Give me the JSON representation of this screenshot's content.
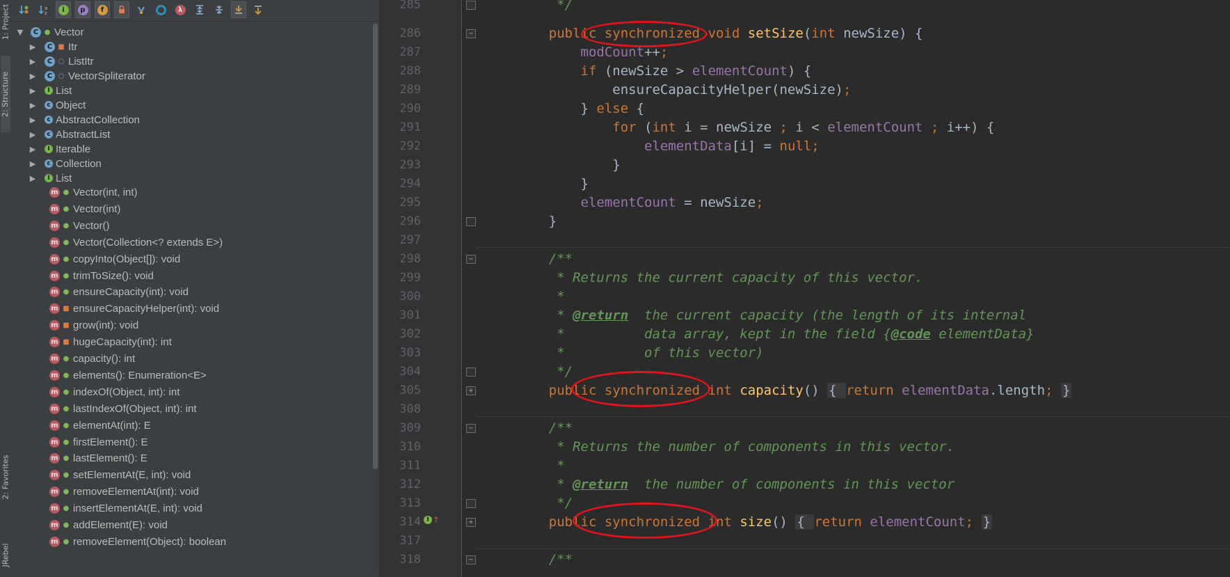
{
  "side_tabs": {
    "project": "1: Project",
    "structure": "2: Structure",
    "favorites": "2: Favorites",
    "jrebel": "JRebel"
  },
  "toolbar": {
    "buttons": [
      "sort-by-visibility",
      "sort-alphabetically",
      "show-inherited",
      "show-properties",
      "show-fields",
      "show-non-public",
      "show-anonymous",
      "show-lambdas",
      "expand-all",
      "collapse-all",
      "autoscroll-to-source",
      "autoscroll-from-source"
    ],
    "show_properties_letter": "p",
    "show_fields_letter": "f",
    "show_lambdas_letter": "λ"
  },
  "structure_tree": {
    "root": "Vector",
    "children": [
      {
        "label": "Itr",
        "kind": "class",
        "vis": "private"
      },
      {
        "label": "ListItr",
        "kind": "class",
        "vis": "package"
      },
      {
        "label": "VectorSpliterator",
        "kind": "class",
        "vis": "package"
      },
      {
        "label": "List",
        "kind": "interface"
      },
      {
        "label": "Object",
        "kind": "class"
      },
      {
        "label": "AbstractCollection",
        "kind": "class"
      },
      {
        "label": "AbstractList",
        "kind": "class"
      },
      {
        "label": "Iterable",
        "kind": "interface"
      },
      {
        "label": "Collection",
        "kind": "interface"
      },
      {
        "label": "List",
        "kind": "interface"
      }
    ],
    "methods": [
      {
        "label": "Vector(int, int)",
        "vis": "public"
      },
      {
        "label": "Vector(int)",
        "vis": "public"
      },
      {
        "label": "Vector()",
        "vis": "public"
      },
      {
        "label": "Vector(Collection<? extends E>)",
        "vis": "public"
      },
      {
        "label": "copyInto(Object[]): void",
        "vis": "public"
      },
      {
        "label": "trimToSize(): void",
        "vis": "public"
      },
      {
        "label": "ensureCapacity(int): void",
        "vis": "public"
      },
      {
        "label": "ensureCapacityHelper(int): void",
        "vis": "private"
      },
      {
        "label": "grow(int): void",
        "vis": "private"
      },
      {
        "label": "hugeCapacity(int): int",
        "vis": "private"
      },
      {
        "label": "capacity(): int",
        "vis": "public"
      },
      {
        "label": "elements(): Enumeration<E>",
        "vis": "public"
      },
      {
        "label": "indexOf(Object, int): int",
        "vis": "public"
      },
      {
        "label": "lastIndexOf(Object, int): int",
        "vis": "public"
      },
      {
        "label": "elementAt(int): E",
        "vis": "public"
      },
      {
        "label": "firstElement(): E",
        "vis": "public"
      },
      {
        "label": "lastElement(): E",
        "vis": "public"
      },
      {
        "label": "setElementAt(E, int): void",
        "vis": "public"
      },
      {
        "label": "removeElementAt(int): void",
        "vis": "public"
      },
      {
        "label": "insertElementAt(E, int): void",
        "vis": "public"
      },
      {
        "label": "addElement(E): void",
        "vis": "public"
      },
      {
        "label": "removeElement(Object): boolean",
        "vis": "public"
      }
    ]
  },
  "editor": {
    "line_numbers": [
      "285",
      "286",
      "287",
      "288",
      "289",
      "290",
      "291",
      "292",
      "293",
      "294",
      "295",
      "296",
      "297",
      "298",
      "299",
      "300",
      "301",
      "302",
      "303",
      "304",
      "305",
      "308",
      "309",
      "310",
      "311",
      "312",
      "313",
      "314",
      "317",
      "318"
    ],
    "code_lines": [
      {
        "n": "285",
        "segs": [
          [
            "doc",
            "     */"
          ]
        ]
      },
      {
        "n": "286",
        "segs": [
          [
            "kw",
            "    public "
          ],
          [
            "kw",
            "synchronized"
          ],
          [
            "kw",
            " void "
          ],
          [
            "fn",
            "setSize"
          ],
          [
            "",
            "("
          ],
          [
            "kw",
            "int "
          ],
          [
            "",
            "newSize) {"
          ]
        ]
      },
      {
        "n": "287",
        "segs": [
          [
            "fld",
            "        modCount"
          ],
          [
            "",
            "++"
          ],
          [
            "kw",
            ";"
          ]
        ]
      },
      {
        "n": "288",
        "segs": [
          [
            "kw",
            "        if "
          ],
          [
            "",
            "(newSize > "
          ],
          [
            "fld",
            "elementCount"
          ],
          [
            "",
            ") {"
          ]
        ]
      },
      {
        "n": "289",
        "segs": [
          [
            "",
            "            ensureCapacityHelper(newSize)"
          ],
          [
            "kw",
            ";"
          ]
        ]
      },
      {
        "n": "290",
        "segs": [
          [
            "",
            "        } "
          ],
          [
            "kw",
            "else "
          ],
          [
            "",
            "{"
          ]
        ]
      },
      {
        "n": "291",
        "segs": [
          [
            "kw",
            "            for "
          ],
          [
            "",
            "("
          ],
          [
            "kw",
            "int "
          ],
          [
            "",
            "i = newSize "
          ],
          [
            "kw",
            "; "
          ],
          [
            "",
            "i < "
          ],
          [
            "fld",
            "elementCount "
          ],
          [
            "kw",
            "; "
          ],
          [
            "",
            "i++) {"
          ]
        ]
      },
      {
        "n": "292",
        "segs": [
          [
            "fld",
            "                elementData"
          ],
          [
            "",
            "[i] = "
          ],
          [
            "kw",
            "null;"
          ]
        ]
      },
      {
        "n": "293",
        "segs": [
          [
            "",
            "            }"
          ]
        ]
      },
      {
        "n": "294",
        "segs": [
          [
            "",
            "        }"
          ]
        ]
      },
      {
        "n": "295",
        "segs": [
          [
            "fld",
            "        elementCount "
          ],
          [
            "",
            "= newSize"
          ],
          [
            "kw",
            ";"
          ]
        ]
      },
      {
        "n": "296",
        "segs": [
          [
            "",
            "    }"
          ]
        ]
      },
      {
        "n": "297",
        "segs": [
          [
            "",
            ""
          ]
        ]
      },
      {
        "n": "298",
        "segs": [
          [
            "doc",
            "    /**"
          ]
        ]
      },
      {
        "n": "299",
        "segs": [
          [
            "doc",
            "     * Returns the current capacity of this vector."
          ]
        ]
      },
      {
        "n": "300",
        "segs": [
          [
            "doc",
            "     *"
          ]
        ]
      },
      {
        "n": "301",
        "segs": [
          [
            "doc",
            "     * "
          ],
          [
            "doctag",
            "@return"
          ],
          [
            "doc",
            "  the current capacity (the length of its internal"
          ]
        ]
      },
      {
        "n": "302",
        "segs": [
          [
            "doc",
            "     *          data array, kept in the field {"
          ],
          [
            "doctag",
            "@code"
          ],
          [
            "doc",
            " elementData}"
          ]
        ]
      },
      {
        "n": "303",
        "segs": [
          [
            "doc",
            "     *          of this vector)"
          ]
        ]
      },
      {
        "n": "304",
        "segs": [
          [
            "doc",
            "     */"
          ]
        ]
      },
      {
        "n": "305",
        "segs": [
          [
            "kw",
            "    public "
          ],
          [
            "kw",
            "synchronized "
          ],
          [
            "kw",
            "int "
          ],
          [
            "fn",
            "capacity"
          ],
          [
            "",
            "() "
          ],
          [
            "box",
            "{ "
          ],
          [
            "kw",
            "return "
          ],
          [
            "fld",
            "elementData"
          ],
          [
            "",
            ".length"
          ],
          [
            "kw",
            "; "
          ],
          [
            "box",
            "}"
          ]
        ]
      },
      {
        "n": "308",
        "segs": [
          [
            "",
            ""
          ]
        ]
      },
      {
        "n": "309",
        "segs": [
          [
            "doc",
            "    /**"
          ]
        ]
      },
      {
        "n": "310",
        "segs": [
          [
            "doc",
            "     * Returns the number of components in this vector."
          ]
        ]
      },
      {
        "n": "311",
        "segs": [
          [
            "doc",
            "     *"
          ]
        ]
      },
      {
        "n": "312",
        "segs": [
          [
            "doc",
            "     * "
          ],
          [
            "doctag",
            "@return"
          ],
          [
            "doc",
            "  the number of components in this vector"
          ]
        ]
      },
      {
        "n": "313",
        "segs": [
          [
            "doc",
            "     */"
          ]
        ]
      },
      {
        "n": "314",
        "segs": [
          [
            "kw",
            "    public "
          ],
          [
            "kw",
            "synchronized "
          ],
          [
            "kw",
            "int "
          ],
          [
            "fn",
            "size"
          ],
          [
            "",
            "() "
          ],
          [
            "box",
            "{ "
          ],
          [
            "kw",
            "return "
          ],
          [
            "fld",
            "elementCount"
          ],
          [
            "kw",
            "; "
          ],
          [
            "box",
            "}"
          ]
        ]
      },
      {
        "n": "317",
        "segs": [
          [
            "",
            ""
          ]
        ]
      },
      {
        "n": "318",
        "segs": [
          [
            "doc",
            "    /**"
          ]
        ]
      }
    ],
    "colors": {
      "keyword": "#cc7832",
      "field": "#9876aa",
      "method": "#ffc66d",
      "doc": "#629755",
      "default": "#a9b7c6",
      "highlight_ring": "#e0161b"
    }
  }
}
